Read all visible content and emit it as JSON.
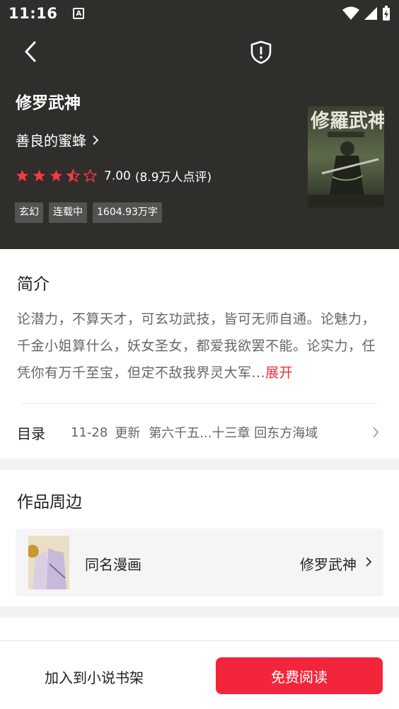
{
  "status_bar": {
    "time": "11:16",
    "notification_badge": "A"
  },
  "book": {
    "title": "修罗武神",
    "author": "善良的蜜蜂",
    "rating_score": "7.00",
    "rating_count": "(8.9万人点评)",
    "rating_stars": 3.5,
    "tags": [
      "玄幻",
      "连载中",
      "1604.93万字"
    ],
    "cover_title_art": "修羅武神"
  },
  "intro": {
    "title": "简介",
    "text": "论潜力，不算天才，可玄功武技，皆可无师自通。论魅力，千金小姐算什么，妖女圣女，都爱我欲罢不能。论实力，任凭你有万千至宝，但定不敌我界灵大军...",
    "more_label": "展开"
  },
  "toc": {
    "label": "目录",
    "date": "11-28",
    "update_label": "更新",
    "latest_chapter": "第六千五...十三章 回东方海域"
  },
  "peripheral": {
    "title": "作品周边",
    "item_label": "同名漫画",
    "item_name": "修罗武神"
  },
  "bottom_bar": {
    "add_shelf_label": "加入到小说书架",
    "read_button_label": "免费阅读"
  },
  "colors": {
    "header_bg": "#2f2e2b",
    "accent_red": "#f12e3c",
    "star_red": "#f43a44"
  }
}
